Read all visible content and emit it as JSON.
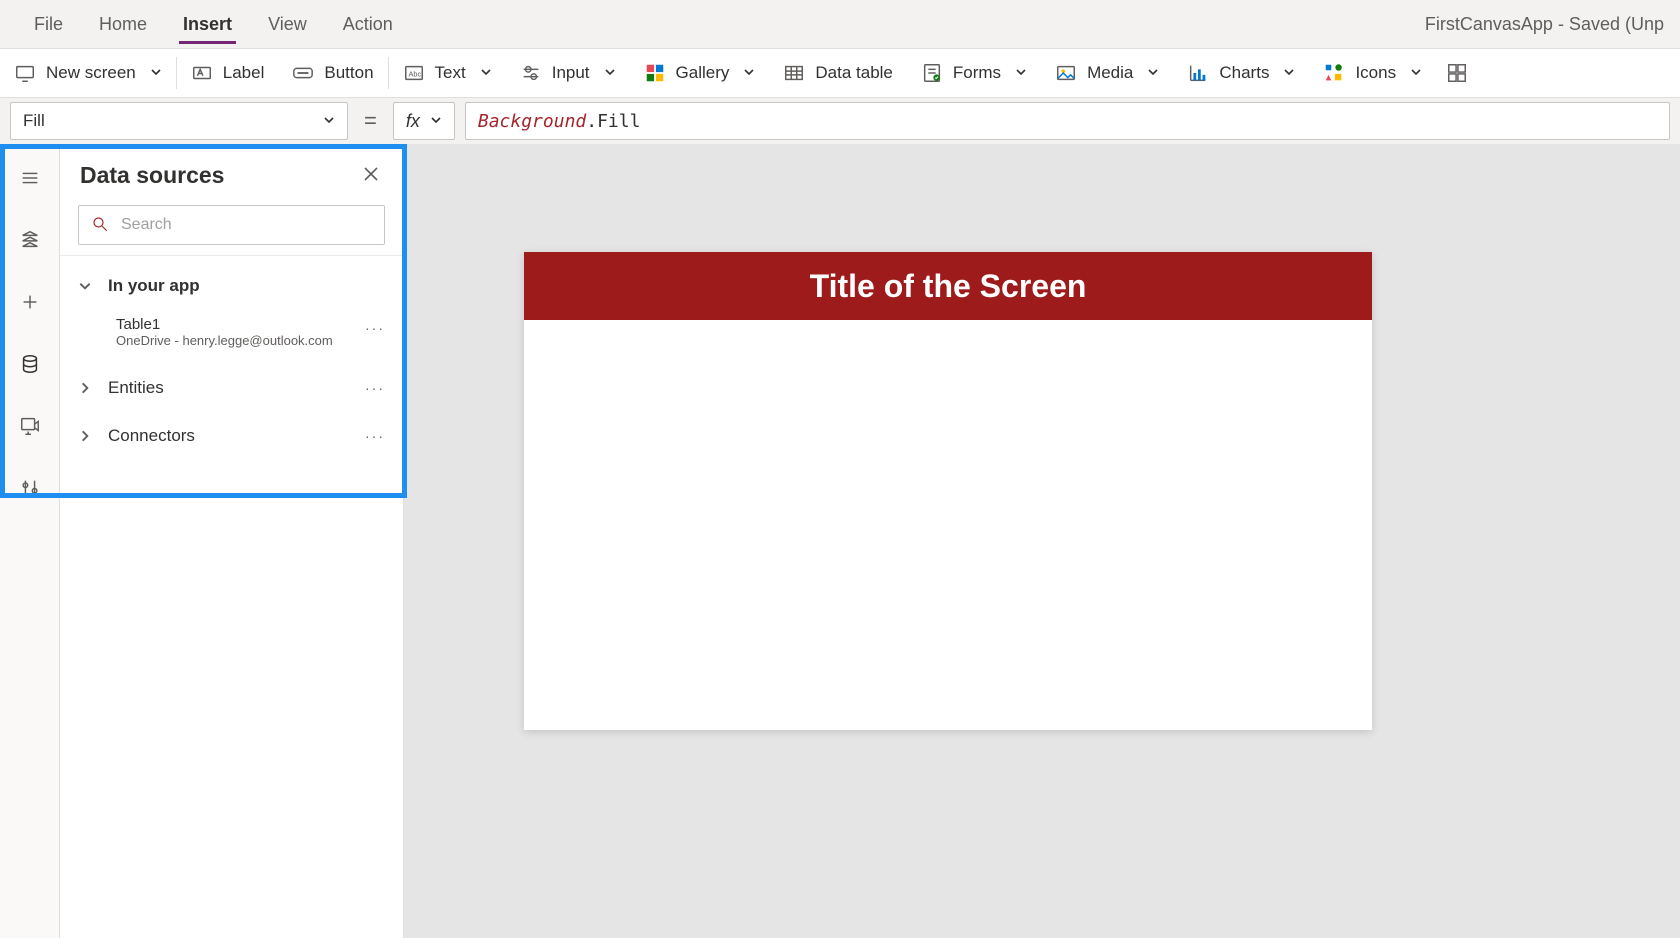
{
  "menubar": {
    "items": [
      "File",
      "Home",
      "Insert",
      "View",
      "Action"
    ],
    "active_index": 2,
    "app_title": "FirstCanvasApp - Saved (Unp"
  },
  "ribbon": {
    "new_screen": "New screen",
    "label": "Label",
    "button": "Button",
    "text": "Text",
    "input": "Input",
    "gallery": "Gallery",
    "data_table": "Data table",
    "forms": "Forms",
    "media": "Media",
    "charts": "Charts",
    "icons": "Icons"
  },
  "formula": {
    "property": "Fill",
    "fx": "fx",
    "equals": "=",
    "expr_obj": "Background",
    "expr_dot": ".",
    "expr_prop": "Fill"
  },
  "panel": {
    "title": "Data sources",
    "search_placeholder": "Search",
    "groups": {
      "in_your_app": {
        "label": "In your app",
        "expanded": true,
        "item": {
          "name": "Table1",
          "source": "OneDrive - henry.legge@outlook.com"
        }
      },
      "entities": {
        "label": "Entities",
        "expanded": false
      },
      "connectors": {
        "label": "Connectors",
        "expanded": false
      }
    }
  },
  "canvas": {
    "title_text": "Title of the Screen"
  }
}
